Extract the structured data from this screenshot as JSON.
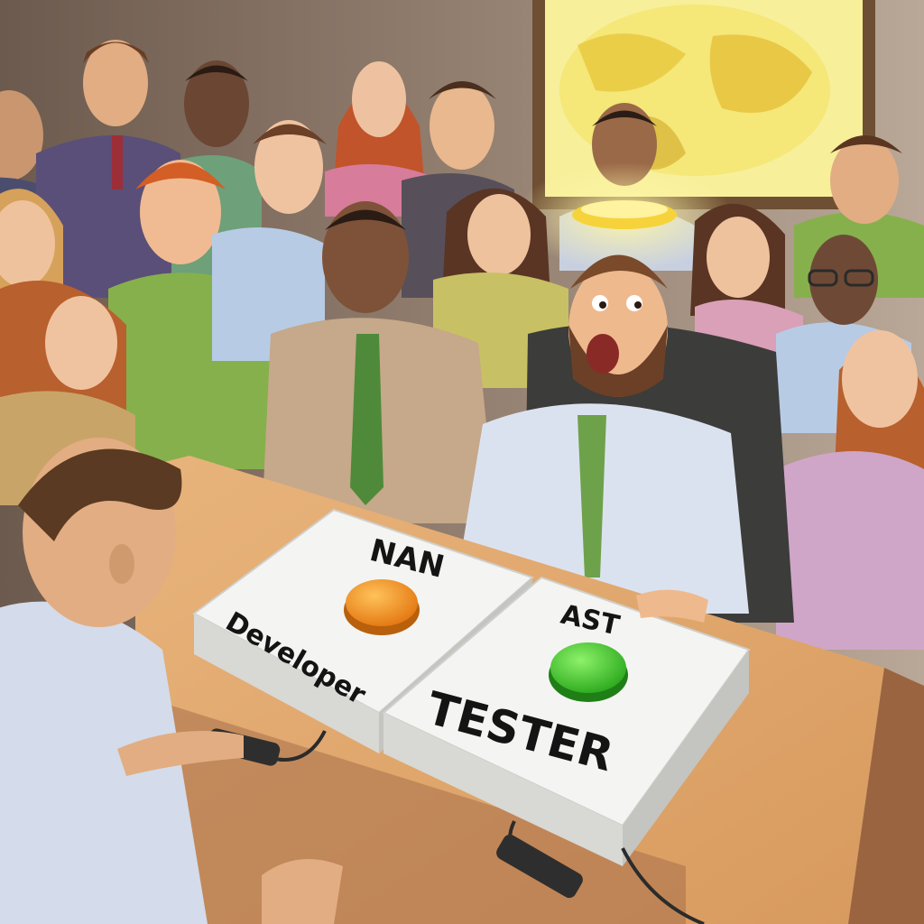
{
  "scene": {
    "caption_left_box_top": "NAN",
    "caption_left_box_bottom": "Developer",
    "caption_right_box_top": "AST",
    "caption_right_box_bottom": "TESTER"
  },
  "colors": {
    "wall": "#8a7566",
    "desk": "#e3ac74",
    "desk_front": "#a8704a",
    "box": "#f4f4f2",
    "button_orange": "#f08a12",
    "button_green": "#3fc52a",
    "map_frame": "#6e4f33",
    "map_glow": "#f7ef9a"
  },
  "icons": {
    "left_button": "orange-push-button-icon",
    "right_button": "green-push-button-icon"
  }
}
